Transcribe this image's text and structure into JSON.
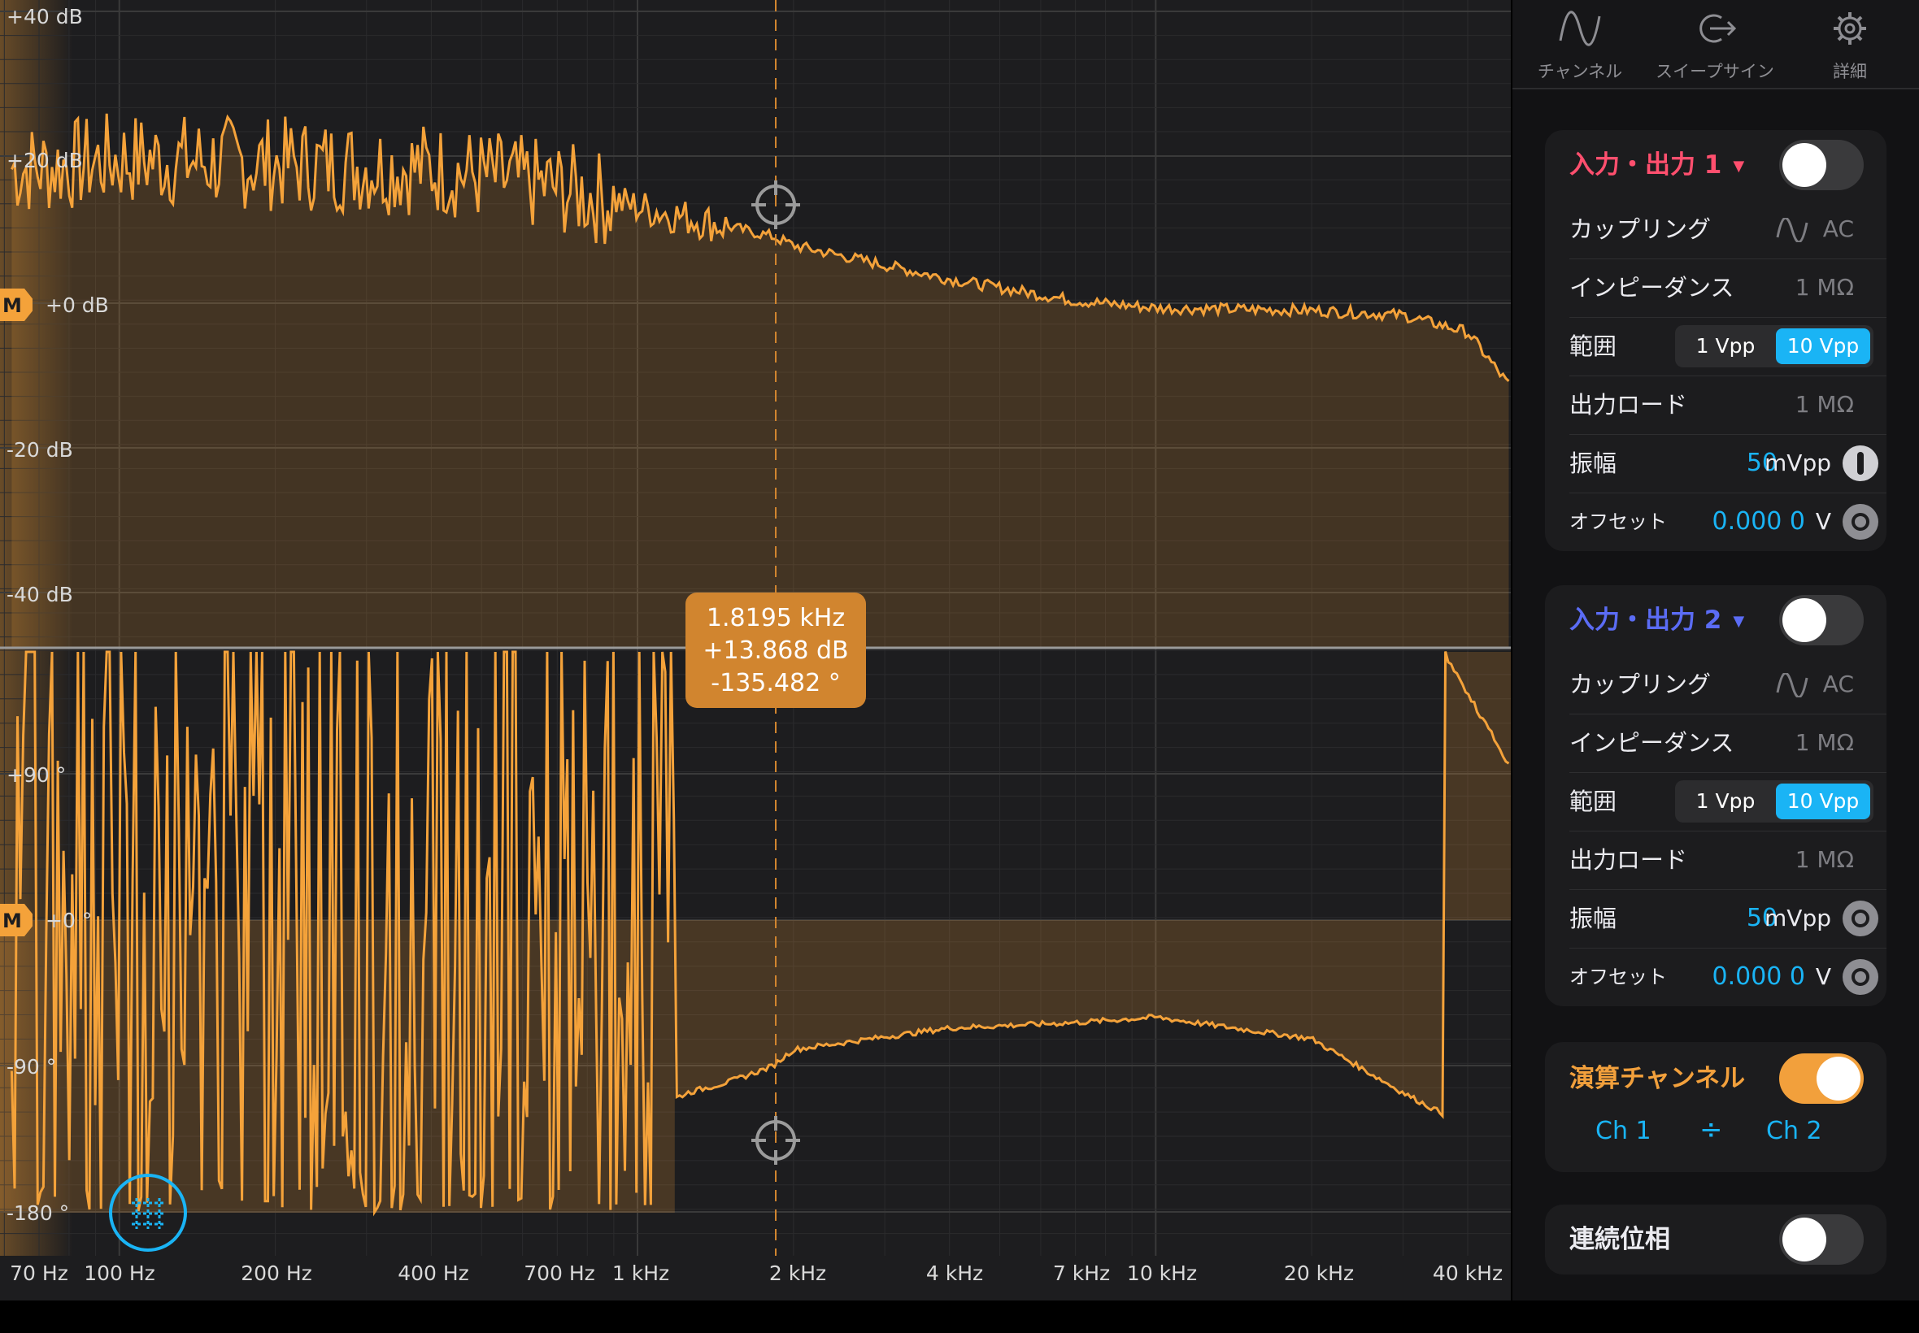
{
  "tabs": [
    {
      "label": "チャンネル",
      "icon": "sine-wave-icon"
    },
    {
      "label": "スイープサイン",
      "icon": "output-arrow-icon"
    },
    {
      "label": "詳細",
      "icon": "gear-icon"
    }
  ],
  "channel1": {
    "title": "入力・出力 1",
    "title_color": "#ff4f6e",
    "enabled": false,
    "coupling_label": "カップリング",
    "coupling_value": "AC",
    "impedance_label": "インピーダンス",
    "impedance_value": "1 MΩ",
    "range_label": "範囲",
    "range_options": [
      "1 Vpp",
      "10 Vpp"
    ],
    "range_selected": "10 Vpp",
    "load_label": "出力ロード",
    "load_value": "1 MΩ",
    "amplitude_label": "振幅",
    "amplitude_value": "50",
    "amplitude_unit": "mVpp",
    "offset_label": "オフセット",
    "offset_value": "0.000 0",
    "offset_unit": "V"
  },
  "channel2": {
    "title": "入力・出力 2",
    "title_color": "#5b6cf5",
    "enabled": false,
    "coupling_label": "カップリング",
    "coupling_value": "AC",
    "impedance_label": "インピーダンス",
    "impedance_value": "1 MΩ",
    "range_label": "範囲",
    "range_options": [
      "1 Vpp",
      "10 Vpp"
    ],
    "range_selected": "10 Vpp",
    "load_label": "出力ロード",
    "load_value": "1 MΩ",
    "amplitude_label": "振幅",
    "amplitude_value": "50",
    "amplitude_unit": "mVpp",
    "offset_label": "オフセット",
    "offset_value": "0.000 0",
    "offset_unit": "V"
  },
  "math_channel": {
    "title": "演算チャンネル",
    "title_color": "#f2a03c",
    "enabled": true,
    "operand_a": "Ch 1",
    "operator": "÷",
    "operand_b": "Ch 2"
  },
  "continuous_phase": {
    "label": "連続位相",
    "enabled": false
  },
  "cursor": {
    "frequency": "1.8195 kHz",
    "magnitude": "+13.868 dB",
    "phase": "-135.482 °"
  },
  "plot": {
    "trace_color": "#f4a23a",
    "magnitude_ticks": [
      "+40 dB",
      "+20 dB",
      "+0 dB",
      "-20 dB",
      "-40 dB"
    ],
    "phase_ticks": [
      "+90 °",
      "+0 °",
      "-90 °",
      "-180 °"
    ],
    "frequency_ticks": [
      "70 Hz",
      "100 Hz",
      "200 Hz",
      "400 Hz",
      "700 Hz",
      "1 kHz",
      "2 kHz",
      "4 kHz",
      "7 kHz",
      "10 kHz",
      "20 kHz",
      "40 kHz"
    ],
    "marker_label": "M"
  },
  "chart_data": {
    "type": "line",
    "x_scale": "log",
    "x_unit": "Hz",
    "xlim": [
      70,
      48000
    ],
    "panels": [
      {
        "name": "magnitude",
        "unit": "dB",
        "ylim": [
          -45,
          42
        ],
        "x": [
          70,
          100,
          200,
          400,
          700,
          1000,
          1820,
          2000,
          4000,
          7000,
          10000,
          20000,
          30000,
          40000,
          48000
        ],
        "y": [
          28,
          30,
          29,
          28,
          24,
          20,
          13.9,
          12,
          5,
          0.5,
          -1,
          -1.5,
          -2.5,
          -6,
          -17
        ]
      },
      {
        "name": "phase",
        "unit": "°",
        "ylim": [
          -180,
          180
        ],
        "x": [
          1000,
          1250,
          1500,
          1820,
          2000,
          4000,
          7000,
          10000,
          20000,
          30000,
          36000
        ],
        "y": [
          -180,
          -160,
          -150,
          -135.5,
          -120,
          -100,
          -95,
          -90,
          -110,
          -160,
          -180
        ]
      }
    ]
  }
}
